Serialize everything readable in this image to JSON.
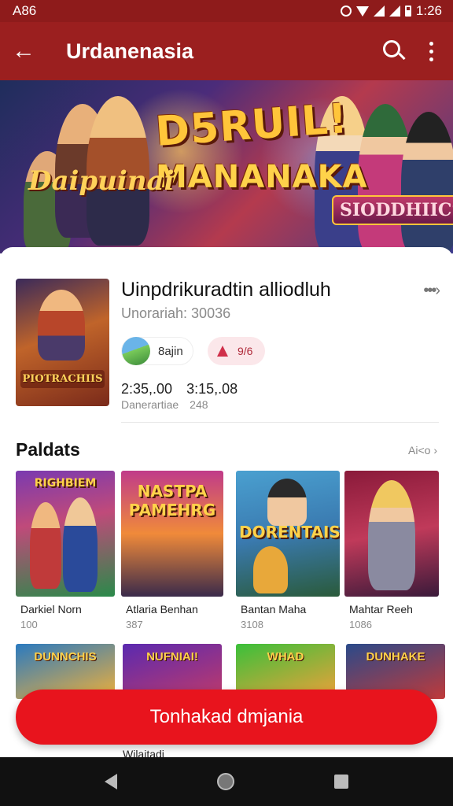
{
  "status_bar": {
    "left_text": "A86",
    "time": "1:26"
  },
  "app_bar": {
    "title": "Urdanenasia"
  },
  "banner": {
    "headline_line1": "D5RUIL!",
    "headline_line2": "MANANAKA",
    "left_logo": "Daipuinai",
    "left_sub": "",
    "right_logo": "SIODDHIICS"
  },
  "app": {
    "name": "Uinpdrikuradtin alliodluh",
    "subtitle": "Unorariah: 30036",
    "icon_logo": "PIOTRACHIIS",
    "developer_chip": "8ajin",
    "rating_chip": "9/6",
    "stat_1_value": "2:35,.00",
    "stat_2_value": "3:15,.08",
    "stat_1_label": "Danerartiae",
    "stat_2_label": "248"
  },
  "section": {
    "title": "Paldats",
    "more": "Ai<o"
  },
  "grid": [
    {
      "name": "Darkiel Norn",
      "meta": "100",
      "logo": "RIGHBIEM"
    },
    {
      "name": "Atlaria Benhan",
      "meta": "387",
      "logo": "NASTPA PAMEHRG"
    },
    {
      "name": "Bantan Maha",
      "meta": "3108",
      "logo": "DORENTAIS"
    },
    {
      "name": "Mahtar Reeh",
      "meta": "1086",
      "logo": ""
    }
  ],
  "row2": [
    {
      "logo": "DUNNCHIS"
    },
    {
      "logo": "NUFNIAI!"
    },
    {
      "logo": "WHAD"
    },
    {
      "logo": "DUNHAKE"
    }
  ],
  "row2_peek_text": "Wilaitadi",
  "install_button": "Tonhakad dmjania",
  "colors": {
    "app_bar": "#9b1f1f",
    "status_bar": "#8e1b1b",
    "primary_button": "#e8141d",
    "rating_chip_bg": "#fbe7ea"
  }
}
